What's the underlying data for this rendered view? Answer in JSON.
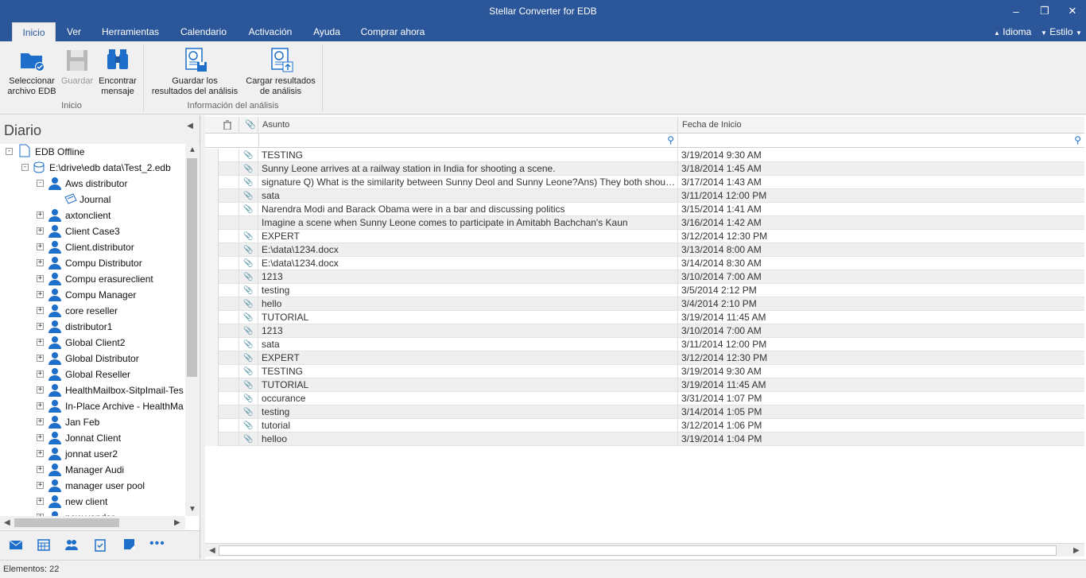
{
  "window": {
    "title": "Stellar Converter for EDB"
  },
  "tabs": [
    "Inicio",
    "Ver",
    "Herramientas",
    "Calendario",
    "Activación",
    "Ayuda",
    "Comprar ahora"
  ],
  "rightmenu": {
    "idioma": "Idioma",
    "estilo": "Estilo"
  },
  "ribbon": {
    "select_edb": "Seleccionar\narchivo EDB",
    "save": "Guardar",
    "find": "Encontrar\nmensaje",
    "group_inicio": "Inicio",
    "save_scan": "Guardar los\nresultados del análisis",
    "load_scan": "Cargar resultados\nde análisis",
    "group_scan": "Información del análisis"
  },
  "leftpane": {
    "title": "Diario",
    "root": "EDB Offline",
    "edb": "E:\\drive\\edb data\\Test_2.edb",
    "mailboxes": [
      "Aws distributor",
      "Journal",
      "axtonclient",
      "Client Case3",
      "Client.distributor",
      "Compu Distributor",
      "Compu erasureclient",
      "Compu Manager",
      "core reseller",
      "distributor1",
      "Global Client2",
      "Global Distributor",
      "Global Reseller",
      "HealthMailbox-SitpImail-Tes",
      "In-Place Archive - HealthMa",
      "Jan Feb",
      "Jonnat Client",
      "jonnat user2",
      "Manager Audi",
      "manager user pool",
      "new client",
      "new vendor"
    ]
  },
  "grid": {
    "col_subject": "Asunto",
    "col_date": "Fecha de Inicio",
    "rows": [
      {
        "att": true,
        "subject": "TESTING",
        "date": "3/19/2014 9:30 AM"
      },
      {
        "att": true,
        "subject": "Sunny Leone arrives at a railway station in India for shooting a scene.",
        "date": "3/18/2014 1:45 AM"
      },
      {
        "att": true,
        "subject": "signature Q) What is the similarity between Sunny Deol and Sunny Leone?Ans) They both shout a lot in their ...",
        "date": "3/17/2014 1:43 AM"
      },
      {
        "att": true,
        "subject": "sata",
        "date": "3/11/2014 12:00 PM"
      },
      {
        "att": true,
        "subject": "Narendra Modi and Barack Obama were in a bar and discussing politics",
        "date": "3/15/2014 1:41 AM"
      },
      {
        "att": false,
        "subject": "Imagine a scene when Sunny Leone comes to participate in Amitabh Bachchan's Kaun",
        "date": "3/16/2014 1:42 AM"
      },
      {
        "att": true,
        "subject": "EXPERT",
        "date": "3/12/2014 12:30 PM"
      },
      {
        "att": true,
        "subject": "E:\\data\\1234.docx",
        "date": "3/13/2014 8:00 AM"
      },
      {
        "att": true,
        "subject": "E:\\data\\1234.docx",
        "date": "3/14/2014 8:30 AM"
      },
      {
        "att": true,
        "subject": "1213",
        "date": "3/10/2014 7:00 AM"
      },
      {
        "att": true,
        "subject": "testing",
        "date": "3/5/2014 2:12 PM"
      },
      {
        "att": true,
        "subject": "hello",
        "date": "3/4/2014 2:10 PM"
      },
      {
        "att": true,
        "subject": "TUTORIAL",
        "date": "3/19/2014 11:45 AM"
      },
      {
        "att": true,
        "subject": "1213",
        "date": "3/10/2014 7:00 AM"
      },
      {
        "att": true,
        "subject": "sata",
        "date": "3/11/2014 12:00 PM"
      },
      {
        "att": true,
        "subject": "EXPERT",
        "date": "3/12/2014 12:30 PM"
      },
      {
        "att": true,
        "subject": "TESTING",
        "date": "3/19/2014 9:30 AM"
      },
      {
        "att": true,
        "subject": "TUTORIAL",
        "date": "3/19/2014 11:45 AM"
      },
      {
        "att": true,
        "subject": "occurance",
        "date": "3/31/2014 1:07 PM"
      },
      {
        "att": true,
        "subject": "testing",
        "date": "3/14/2014 1:05 PM"
      },
      {
        "att": true,
        "subject": "tutorial",
        "date": "3/12/2014 1:06 PM"
      },
      {
        "att": true,
        "subject": "helloo",
        "date": "3/19/2014 1:04 PM"
      }
    ]
  },
  "status": {
    "text": "Elementos: 22"
  },
  "colors": {
    "titlebar": "#2b579a",
    "accent": "#1e6fc9"
  }
}
